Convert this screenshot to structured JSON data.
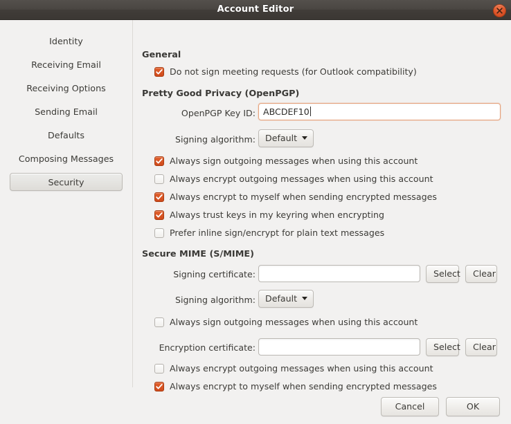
{
  "window": {
    "title": "Account Editor",
    "close_icon": "close-icon"
  },
  "sidebar": {
    "items": [
      {
        "label": "Identity",
        "selected": false
      },
      {
        "label": "Receiving Email",
        "selected": false
      },
      {
        "label": "Receiving Options",
        "selected": false
      },
      {
        "label": "Sending Email",
        "selected": false
      },
      {
        "label": "Defaults",
        "selected": false
      },
      {
        "label": "Composing Messages",
        "selected": false
      },
      {
        "label": "Security",
        "selected": true
      }
    ]
  },
  "content": {
    "general": {
      "title": "General",
      "do_not_sign_label": "Do not sign meeting requests (for Outlook compatibility)",
      "do_not_sign_checked": true
    },
    "pgp": {
      "title": "Pretty Good Privacy (OpenPGP)",
      "key_id_label": "OpenPGP Key ID:",
      "key_id_value": "ABCDEF10",
      "key_id_placeholder": "",
      "signing_algorithm_label": "Signing algorithm:",
      "signing_algorithm_value": "Default",
      "options": [
        {
          "label": "Always sign outgoing messages when using this account",
          "checked": true
        },
        {
          "label": "Always encrypt outgoing messages when using this account",
          "checked": false
        },
        {
          "label": "Always encrypt to myself when sending encrypted messages",
          "checked": true
        },
        {
          "label": "Always trust keys in my keyring when encrypting",
          "checked": true
        },
        {
          "label": "Prefer inline sign/encrypt for plain text messages",
          "checked": false
        }
      ]
    },
    "smime": {
      "title": "Secure MIME (S/MIME)",
      "signing_certificate_label": "Signing certificate:",
      "signing_certificate_value": "",
      "signing_select_label": "Select",
      "signing_clear_label": "Clear",
      "signing_algorithm_label": "Signing algorithm:",
      "signing_algorithm_value": "Default",
      "always_sign_label": "Always sign outgoing messages when using this account",
      "always_sign_checked": false,
      "encryption_certificate_label": "Encryption certificate:",
      "encryption_certificate_value": "",
      "encryption_select_label": "Select",
      "encryption_clear_label": "Clear",
      "always_encrypt_outgoing_label": "Always encrypt outgoing messages when using this account",
      "always_encrypt_outgoing_checked": false,
      "always_encrypt_self_label": "Always encrypt to myself when sending encrypted messages",
      "always_encrypt_self_checked": true
    }
  },
  "footer": {
    "cancel_label": "Cancel",
    "ok_label": "OK"
  },
  "colors": {
    "accent": "#d4501c",
    "titlebar": "#453f3b",
    "background": "#f2f1f0",
    "focus_border": "#e6a47e"
  }
}
